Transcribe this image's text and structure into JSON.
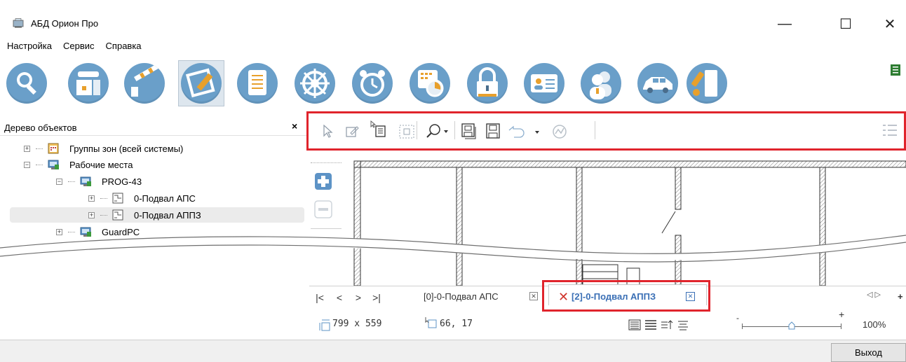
{
  "window": {
    "title": "АБД Орион Про",
    "minimize": "—",
    "maximize": "☐",
    "close": "✕"
  },
  "menu": [
    "Настройка",
    "Сервис",
    "Справка"
  ],
  "big_toolbar": [
    {
      "icon": "search-magnifier-icon"
    },
    {
      "icon": "device-monitor-icon"
    },
    {
      "icon": "barrier-gate-icon"
    },
    {
      "icon": "floor-plan-editor-icon",
      "active": true
    },
    {
      "icon": "document-list-icon"
    },
    {
      "icon": "helm-wheel-icon"
    },
    {
      "icon": "alarm-clock-icon"
    },
    {
      "icon": "schedule-dial-icon"
    },
    {
      "icon": "lock-icon"
    },
    {
      "icon": "id-card-icon"
    },
    {
      "icon": "users-icon"
    },
    {
      "icon": "car-icon"
    },
    {
      "icon": "key-icon"
    }
  ],
  "panel": {
    "title": "Дерево объектов",
    "close": "×"
  },
  "tree": [
    {
      "label": "Группы зон (всей системы)",
      "level": 1,
      "expander": "+",
      "icon": "zone-groups-icon"
    },
    {
      "label": "Рабочие места",
      "level": 1,
      "expander": "−",
      "icon": "workstations-icon"
    },
    {
      "label": "PROG-43",
      "level": 2,
      "expander": "−",
      "icon": "workstation-icon"
    },
    {
      "label": "0-Подвал АПС",
      "level": 3,
      "expander": "+",
      "icon": "plan-icon"
    },
    {
      "label": "0-Подвал АППЗ",
      "level": 3,
      "expander": "+",
      "icon": "plan-icon",
      "selected": true
    },
    {
      "label": "GuardPC",
      "level": 2,
      "expander": "+",
      "icon": "workstation-icon"
    }
  ],
  "tabs": {
    "first": "|<",
    "prev": "<",
    "next": ">",
    "last": ">|",
    "tab0_label": "[0]-0-Подвал АПС",
    "tab0_close": "✕",
    "tab2_label": "[2]-0-Подвал АППЗ",
    "tab2_close": "✕",
    "scroll": "◁ ▷",
    "add": "+"
  },
  "status": {
    "size": "799 x 559",
    "coords": "66, 17",
    "zoom": "100%",
    "zoom_level": 0.5,
    "plus": "+",
    "minus": "-"
  },
  "footer": {
    "exit_label": "Выход"
  },
  "colors": {
    "icon_blue": "#6a9fc9",
    "highlight_red": "#e0242c",
    "active_tab_text": "#3a6fb5"
  }
}
